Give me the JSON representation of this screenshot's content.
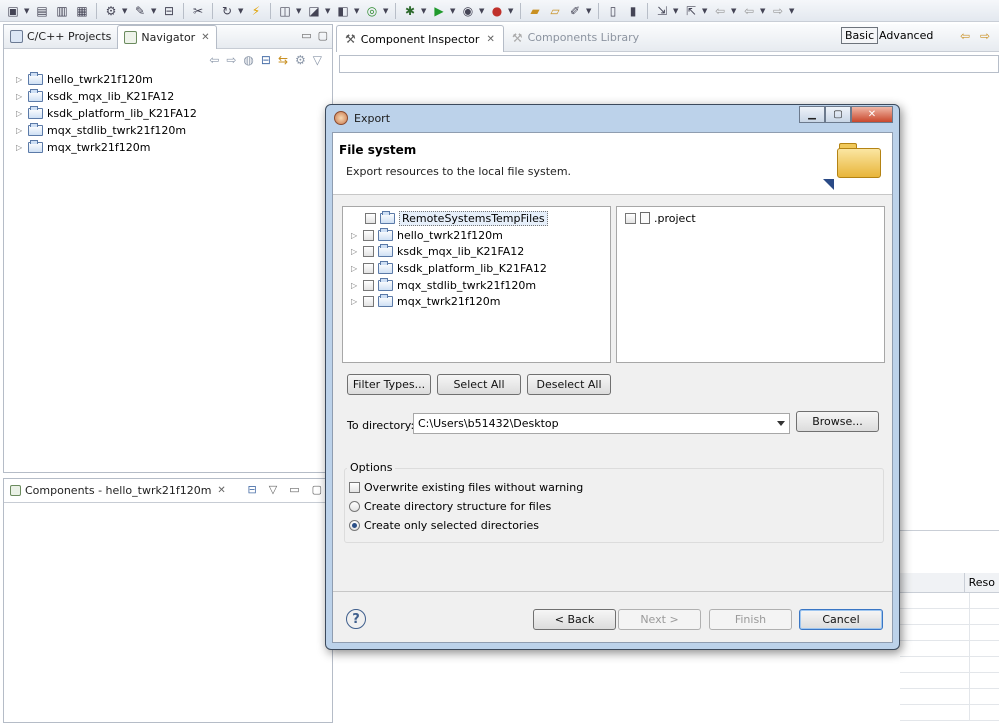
{
  "toolbar": {
    "icons": [
      "new-icon",
      "save-icon",
      "save-all-icon",
      "print-icon",
      "build-icon",
      "wrench-icon",
      "binary-icon",
      "debug-icon",
      "lightning-icon",
      "new-c-icon",
      "new-class-icon",
      "new-file-icon",
      "refresh-icon",
      "bug-icon",
      "run-icon",
      "run-debug-icon",
      "run-stop-icon",
      "folder-icon",
      "open-folder-icon",
      "tool-icon",
      "panel-icon",
      "panel2-icon",
      "edit-icon",
      "nav-icon",
      "back-icon",
      "forward-icon",
      "prev-icon",
      "next-icon"
    ]
  },
  "navigator_pane": {
    "tabs": [
      {
        "label": "C/C++ Projects",
        "active": false
      },
      {
        "label": "Navigator",
        "active": true
      }
    ],
    "items": [
      {
        "label": "hello_twrk21f120m"
      },
      {
        "label": "ksdk_mqx_lib_K21FA12"
      },
      {
        "label": "ksdk_platform_lib_K21FA12"
      },
      {
        "label": "mqx_stdlib_twrk21f120m"
      },
      {
        "label": "mqx_twrk21f120m"
      }
    ]
  },
  "components_pane": {
    "tab_label": "Components - hello_twrk21f120m"
  },
  "inspector": {
    "tabs": [
      {
        "label": "Component Inspector",
        "active": true
      },
      {
        "label": "Components Library",
        "active": false
      }
    ],
    "basic_label": "Basic",
    "advanced_label": "Advanced",
    "table_header": "Reso"
  },
  "dialog": {
    "title": "Export",
    "banner_title": "File system",
    "banner_desc": "Export resources to the local file system.",
    "left_tree": [
      {
        "label": "RemoteSystemsTempFiles",
        "expandable": false,
        "selected": true
      },
      {
        "label": "hello_twrk21f120m",
        "expandable": true,
        "selected": false
      },
      {
        "label": "ksdk_mqx_lib_K21FA12",
        "expandable": true,
        "selected": false
      },
      {
        "label": "ksdk_platform_lib_K21FA12",
        "expandable": true,
        "selected": false
      },
      {
        "label": "mqx_stdlib_twrk21f120m",
        "expandable": true,
        "selected": false
      },
      {
        "label": "mqx_twrk21f120m",
        "expandable": true,
        "selected": false
      }
    ],
    "right_list": [
      {
        "label": ".project"
      }
    ],
    "filter_types_label": "Filter Types...",
    "select_all_label": "Select All",
    "deselect_all_label": "Deselect All",
    "to_directory_label": "To directory:",
    "to_directory_value": "C:\\Users\\b51432\\Desktop",
    "browse_label": "Browse...",
    "options_label": "Options",
    "options": [
      {
        "label": "Overwrite existing files without warning",
        "kind": "checkbox",
        "checked": false
      },
      {
        "label": "Create directory structure for files",
        "kind": "radio",
        "checked": false
      },
      {
        "label": "Create only selected directories",
        "kind": "radio",
        "checked": true
      }
    ],
    "back_label": "< Back",
    "next_label": "Next >",
    "finish_label": "Finish",
    "cancel_label": "Cancel"
  }
}
